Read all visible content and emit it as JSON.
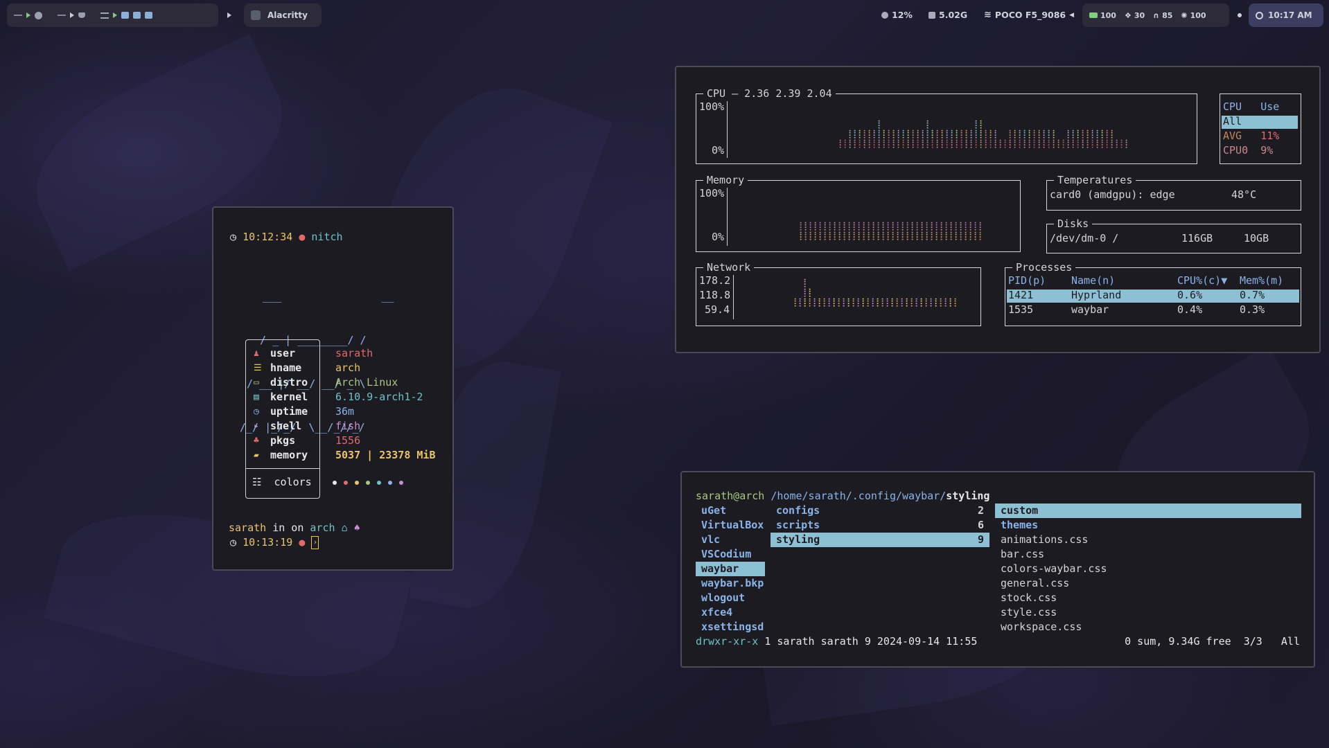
{
  "topbar": {
    "window_title": "Alacritty",
    "cpu": "12%",
    "memory": "5.02G",
    "wifi": "POCO F5_9086",
    "battery": "100",
    "updates": "30",
    "headphones": "85",
    "brightness": "100",
    "clock": "10:17 AM"
  },
  "nitch": {
    "time1": "10:12:34",
    "cmd": "nitch",
    "ascii": [
      " ___                __",
      " / _ | ________/ /",
      "/ __ |/ __/ __/ _ \\",
      "/_/ |_/_/  \\__/_//_/"
    ],
    "rows": [
      {
        "icon": "user-icon",
        "key": "user",
        "value": "sarath",
        "color": "#e06b6b"
      },
      {
        "icon": "hostname-icon",
        "key": "hname",
        "value": "arch",
        "color": "#e9c46a"
      },
      {
        "icon": "distro-icon",
        "key": "distro",
        "value": "Arch Linux",
        "color": "#a8c97f"
      },
      {
        "icon": "kernel-icon",
        "key": "kernel",
        "value": "6.10.9-arch1-2",
        "color": "#6fc2c6"
      },
      {
        "icon": "clock-icon",
        "key": "uptime",
        "value": "36m",
        "color": "#8ab4e8"
      },
      {
        "icon": "terminal-icon",
        "key": "shell",
        "value": "fish",
        "color": "#c88fd0"
      },
      {
        "icon": "package-icon",
        "key": "pkgs",
        "value": "1556",
        "color": "#e06b6b"
      },
      {
        "icon": "memory-icon",
        "key": "memory",
        "value": "5037 | 23378 MiB",
        "color": "#e9c46a"
      }
    ],
    "colors_label": "colors",
    "palette": [
      "#e8e8e8",
      "#e06b6b",
      "#e9c46a",
      "#a8c97f",
      "#6fc2c6",
      "#8ab4e8",
      "#c88fd0"
    ],
    "prompt_user": "sarath",
    "prompt_in_on": "in on",
    "prompt_host": "arch",
    "time2": "10:13:19"
  },
  "btop": {
    "cpu_title": "CPU — 2.36 2.39 2.04",
    "cpu_100": "100%",
    "cpu_0": "0%",
    "cpu_table": {
      "h1": "CPU",
      "h2": "Use",
      "r1": "All",
      "r2a": "AVG",
      "r2b": "11%",
      "r3a": "CPU0",
      "r3b": "9%"
    },
    "mem_title": "Memory",
    "mem_100": "100%",
    "mem_0": "0%",
    "temp_title": "Temperatures",
    "temp_name": "card0 (amdgpu): edge",
    "temp_val": "48°C",
    "disk_title": "Disks",
    "disk_name": "/dev/dm-0 /",
    "disk_total": "116GB",
    "disk_used": "10GB",
    "net_title": "Network",
    "net_values": [
      "178.2",
      "118.8",
      "59.4"
    ],
    "proc_title": "Processes",
    "proc_headers": [
      "PID(p)",
      "Name(n)",
      "CPU%(c)▼",
      "Mem%(m)"
    ],
    "proc_rows": [
      [
        "1421",
        "Hyprland",
        "0.6%",
        "0.7%"
      ],
      [
        "1535",
        "waybar",
        "0.4%",
        "0.3%"
      ]
    ]
  },
  "lf": {
    "prompt_user": "sarath@arch",
    "path": "/home/sarath/.config/waybar/",
    "path_tail": "styling",
    "col1": [
      "uGet",
      "VirtualBox",
      "vlc",
      "VSCodium",
      "waybar",
      "waybar.bkp",
      "wlogout",
      "xfce4",
      "xsettingsd"
    ],
    "col2": [
      {
        "name": "configs",
        "count": "2"
      },
      {
        "name": "scripts",
        "count": "6"
      },
      {
        "name": "styling",
        "count": "9"
      }
    ],
    "col3": [
      "custom",
      "themes",
      "animations.css",
      "bar.css",
      "colors-waybar.css",
      "general.css",
      "stock.css",
      "style.css",
      "workspace.css"
    ],
    "perms": "drwxr-xr-x",
    "status_info": "1 sarath sarath 9 2024-09-14 11:55",
    "status_right": "0 sum, 9.34G free  3/3   All"
  }
}
